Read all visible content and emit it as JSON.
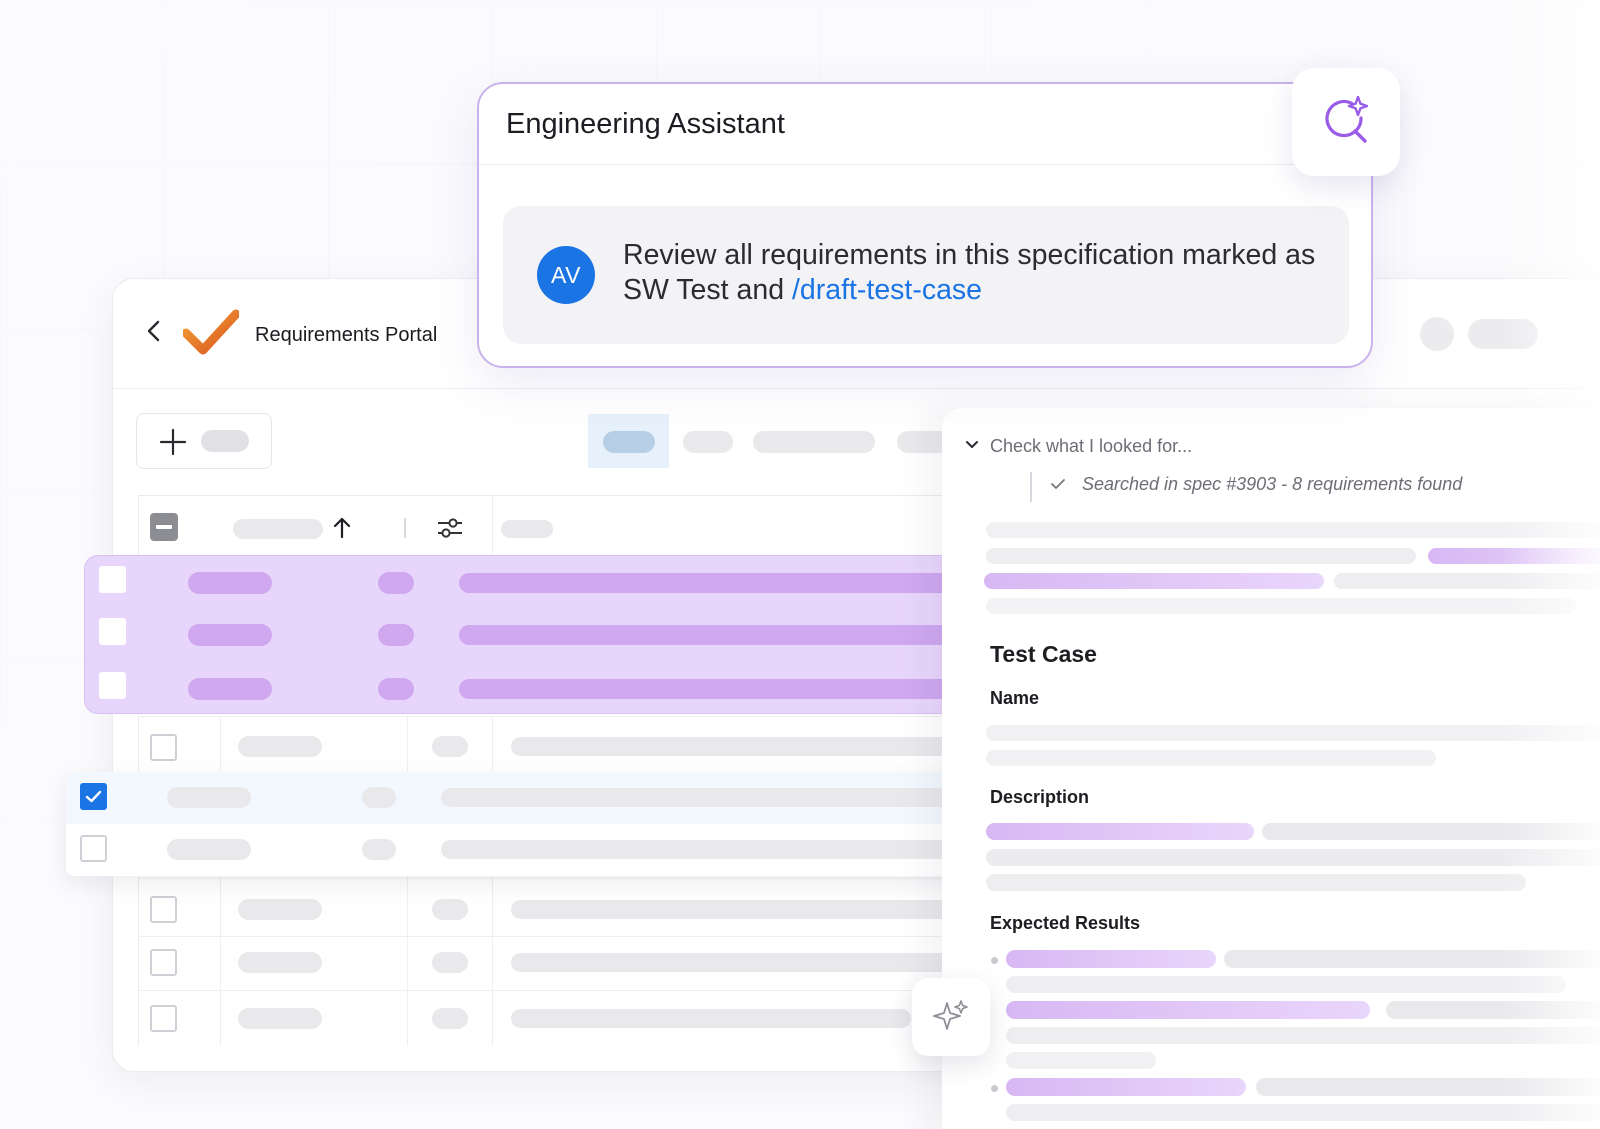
{
  "assistant": {
    "title": "Engineering Assistant",
    "avatar_initials": "AV",
    "message_text": "Review all requirements in this specification marked as SW Test and ",
    "message_command": "/draft-test-case",
    "sparkle_icon": "ai-search-icon"
  },
  "portal": {
    "title": "Requirements Portal",
    "back_icon": "chevron-left-icon",
    "logo": "checkmark-logo"
  },
  "panel": {
    "check_toggle": "Check what I looked for...",
    "search_result": "Searched in spec #3903 - 8 requirements found",
    "section_title": "Test Case",
    "name_label": "Name",
    "description_label": "Description",
    "expected_label": "Expected Results"
  },
  "colors": {
    "accent_blue": "#1b74e4",
    "accent_purple": "#c9b3ee",
    "selection": "#e8d5fb"
  }
}
